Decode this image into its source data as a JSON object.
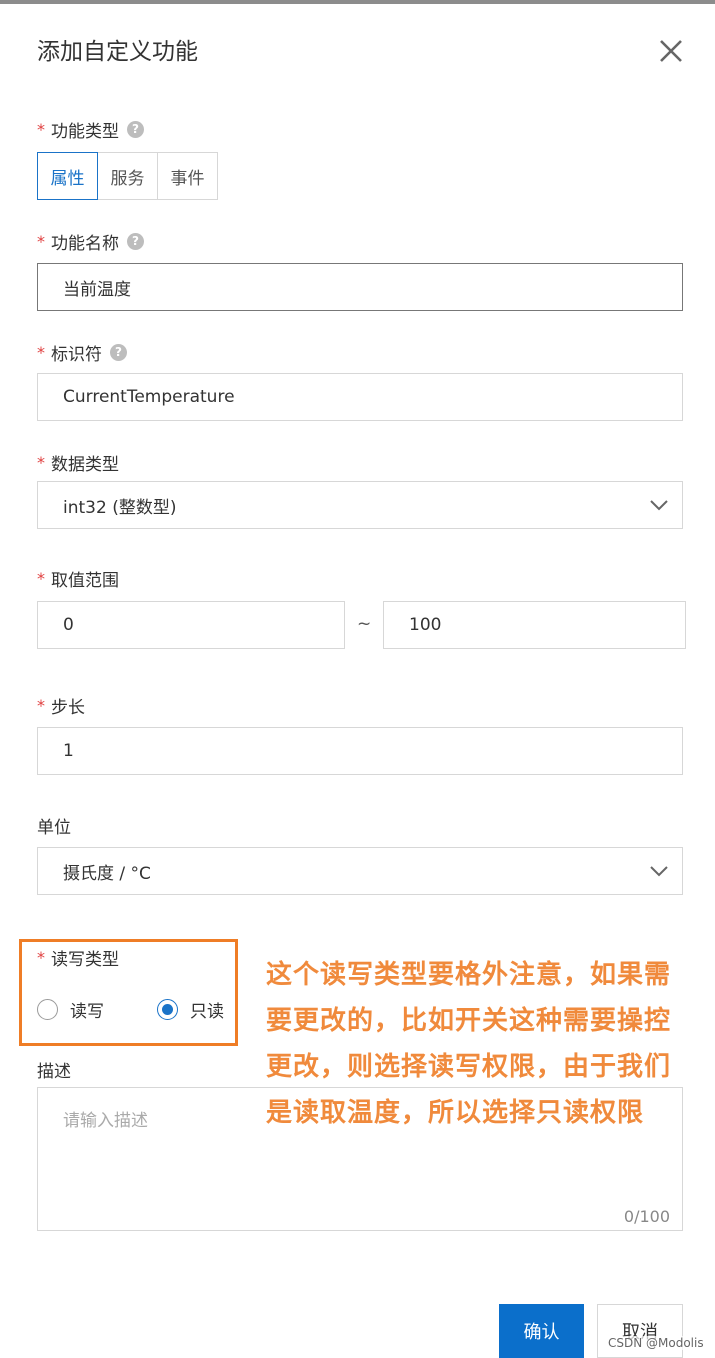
{
  "dialog": {
    "title": "添加自定义功能"
  },
  "form": {
    "function_type": {
      "label": "功能类型",
      "options": [
        "属性",
        "服务",
        "事件"
      ],
      "selected": "属性"
    },
    "function_name": {
      "label": "功能名称",
      "value": "当前温度"
    },
    "identifier": {
      "label": "标识符",
      "value": "CurrentTemperature"
    },
    "data_type": {
      "label": "数据类型",
      "value": "int32 (整数型)"
    },
    "value_range": {
      "label": "取值范围",
      "min": "0",
      "separator": "~",
      "max": "100"
    },
    "step": {
      "label": "步长",
      "value": "1"
    },
    "unit": {
      "label": "单位",
      "value": "摄氏度 / °C"
    },
    "rw_type": {
      "label": "读写类型",
      "options": [
        "读写",
        "只读"
      ],
      "selected": "只读"
    },
    "description": {
      "label": "描述",
      "placeholder": "请输入描述",
      "counter": "0/100"
    }
  },
  "footer": {
    "confirm_label": "确认",
    "cancel_label": "取消"
  },
  "annotation": {
    "text": "这个读写类型要格外注意，如果需要更改的，比如开关这种需要操控更改，则选择读写权限，由于我们是读取温度，所以选择只读权限",
    "color": "#f08a3c"
  },
  "watermark": "CSDN @Modolis",
  "colors": {
    "accent": "#1a73c8",
    "primary_button": "#0b6fcb",
    "required_star": "#e04040",
    "highlight_box": "#ef7d26"
  }
}
